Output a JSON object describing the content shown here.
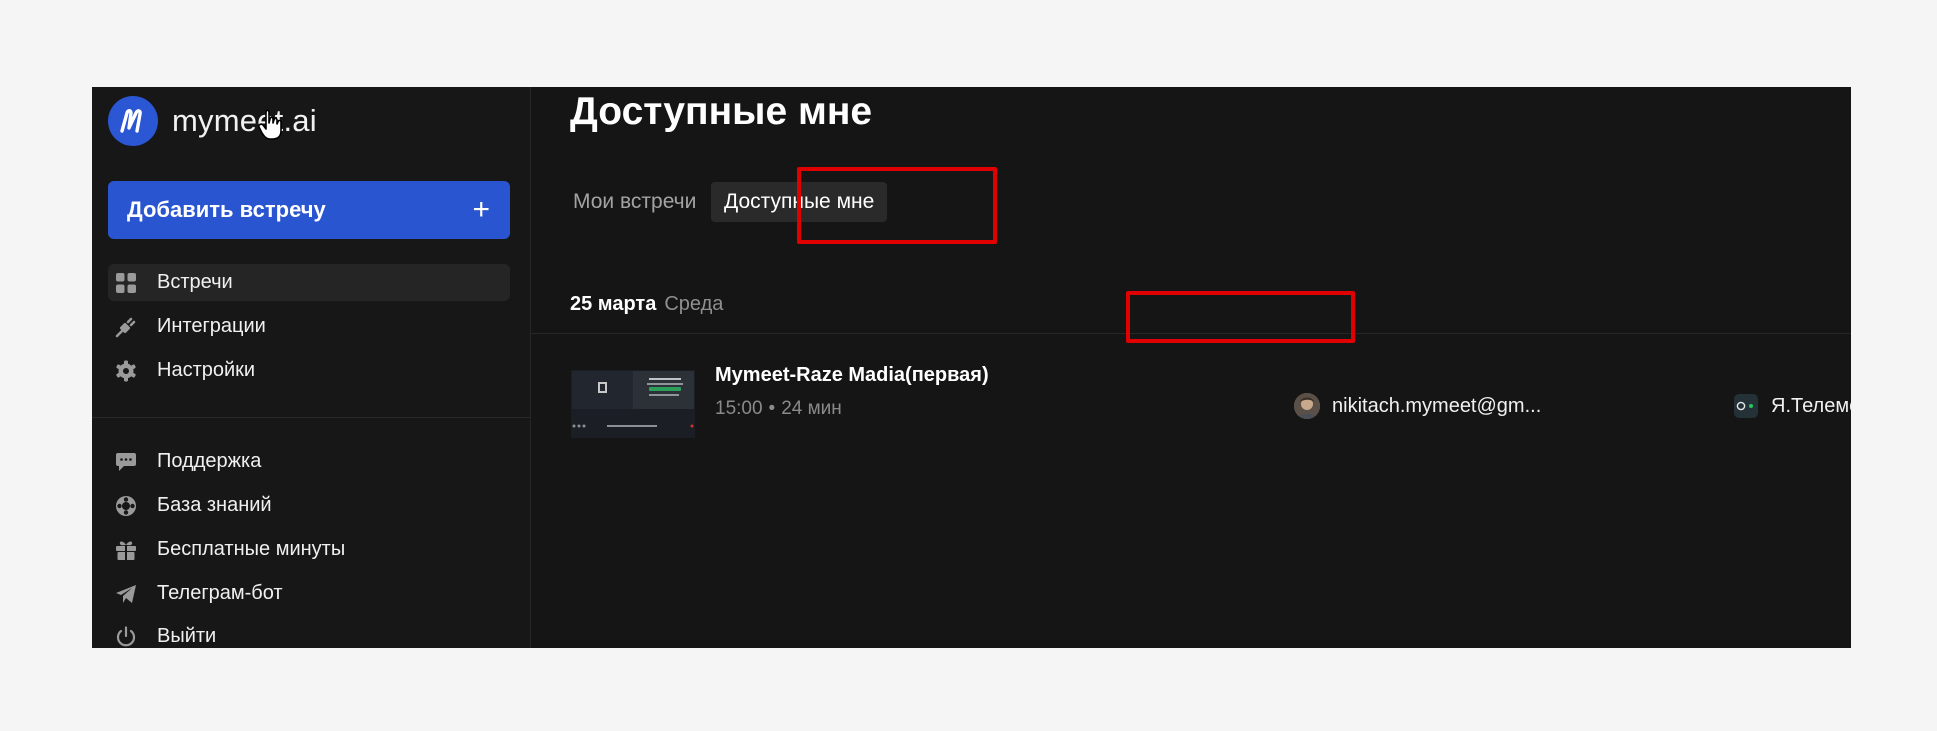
{
  "brand": {
    "name": "mymeet.ai",
    "accent": "#2a55d1",
    "highlight": "#e00000"
  },
  "sidebar": {
    "add_button": {
      "label": "Добавить встречу",
      "icon": "plus-icon"
    },
    "items": [
      {
        "label": "Встречи",
        "icon": "grid-icon",
        "active": true
      },
      {
        "label": "Интеграции",
        "icon": "plug-icon"
      },
      {
        "label": "Настройки",
        "icon": "gear-icon"
      }
    ],
    "secondary_items": [
      {
        "label": "Поддержка",
        "icon": "chat-bubble-icon"
      },
      {
        "label": "База знаний",
        "icon": "lifebuoy-icon"
      },
      {
        "label": "Бесплатные минуты",
        "icon": "gift-icon"
      },
      {
        "label": "Телеграм-бот",
        "icon": "paper-plane-icon"
      },
      {
        "label": "Выйти",
        "icon": "power-icon"
      }
    ]
  },
  "main": {
    "title": "Доступные мне",
    "tabs": [
      {
        "label": "Мои встречи",
        "active": false
      },
      {
        "label": "Доступные мне",
        "active": true
      }
    ],
    "date_group": {
      "date": "25 марта",
      "weekday": "Среда"
    },
    "meetings": [
      {
        "title": "Mymeet-Raze Madia(первая)",
        "time": "15:00",
        "separator": "•",
        "duration": "24 мин",
        "owner_email": "nikitach.mymeet@gm...",
        "platform": "Я.Телемост"
      }
    ]
  }
}
